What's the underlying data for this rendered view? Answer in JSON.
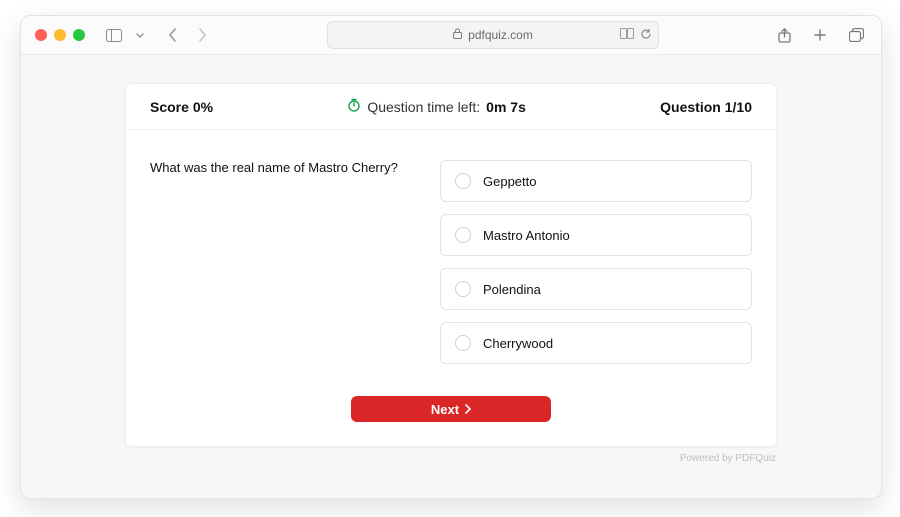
{
  "browser": {
    "url_display": "pdfquiz.com"
  },
  "header": {
    "score_label": "Score",
    "score_value": "0%",
    "timer_label": "Question time left:",
    "timer_value": "0m 7s",
    "question_label": "Question",
    "question_value": "1/10"
  },
  "quiz": {
    "question": "What was the real name of Mastro Cherry?",
    "options": [
      {
        "label": "Geppetto"
      },
      {
        "label": "Mastro Antonio"
      },
      {
        "label": "Polendina"
      },
      {
        "label": "Cherrywood"
      }
    ],
    "next_label": "Next"
  },
  "footer": {
    "powered_by": "Powered by PDFQuiz"
  }
}
